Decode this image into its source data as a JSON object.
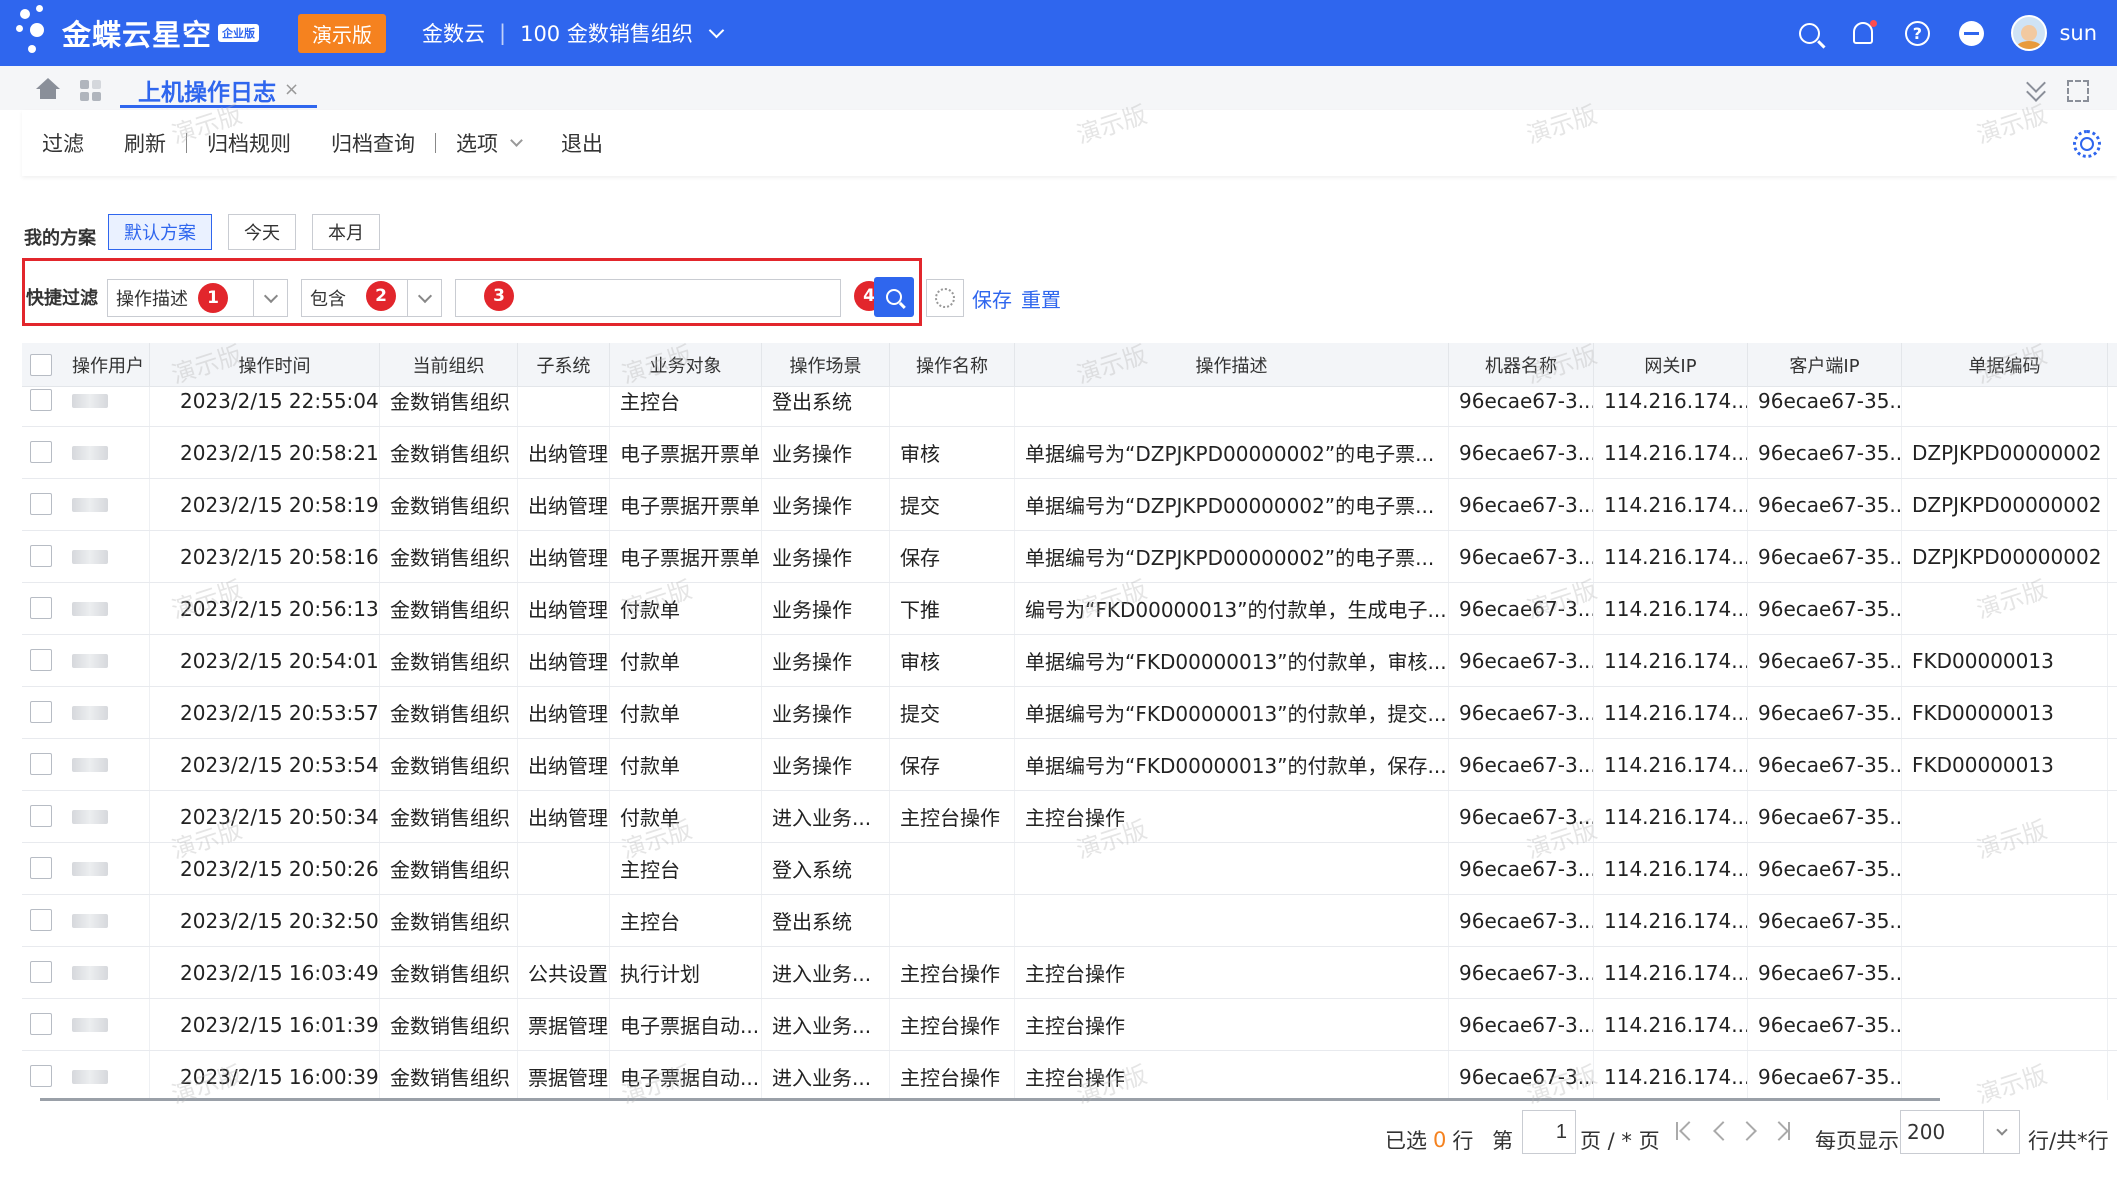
{
  "app": {
    "logo_text": "金蝶云星空",
    "logo_edition": "企业版",
    "demo_badge": "演示版",
    "cloud_name": "金数云",
    "org_name": "100 金数销售组织",
    "username": "sun"
  },
  "tabs": {
    "active_label": "上机操作日志"
  },
  "toolbar": {
    "filter": "过滤",
    "refresh": "刷新",
    "archive_rule": "归档规则",
    "archive_query": "归档查询",
    "options": "选项",
    "exit": "退出"
  },
  "scheme": {
    "label": "我的方案",
    "buttons": [
      "默认方案",
      "今天",
      "本月"
    ],
    "active": "默认方案"
  },
  "quick_filter": {
    "label": "快捷过滤",
    "field_value": "操作描述",
    "operator_value": "包含",
    "keyword_value": "",
    "save": "保存",
    "reset": "重置",
    "badges": [
      "1",
      "2",
      "3",
      "4"
    ]
  },
  "table": {
    "columns": [
      "操作用户",
      "操作时间",
      "当前组织",
      "子系统",
      "业务对象",
      "操作场景",
      "操作名称",
      "操作描述",
      "机器名称",
      "网关IP",
      "客户端IP",
      "单据编码"
    ],
    "rows": [
      [
        "",
        "2023/2/15 22:55:04",
        "金数销售组织",
        "",
        "主控台",
        "登出系统",
        "",
        "",
        "96ecae67-3...",
        "114.216.174....",
        "96ecae67-35...",
        ""
      ],
      [
        "",
        "2023/2/15 20:58:21",
        "金数销售组织",
        "出纳管理",
        "电子票据开票单",
        "业务操作",
        "审核",
        "单据编号为“DZPJKPD00000002”的电子票...",
        "96ecae67-3...",
        "114.216.174....",
        "96ecae67-35...",
        "DZPJKPD00000002"
      ],
      [
        "",
        "2023/2/15 20:58:19",
        "金数销售组织",
        "出纳管理",
        "电子票据开票单",
        "业务操作",
        "提交",
        "单据编号为“DZPJKPD00000002”的电子票...",
        "96ecae67-3...",
        "114.216.174....",
        "96ecae67-35...",
        "DZPJKPD00000002"
      ],
      [
        "",
        "2023/2/15 20:58:16",
        "金数销售组织",
        "出纳管理",
        "电子票据开票单",
        "业务操作",
        "保存",
        "单据编号为“DZPJKPD00000002”的电子票...",
        "96ecae67-3...",
        "114.216.174....",
        "96ecae67-35...",
        "DZPJKPD00000002"
      ],
      [
        "",
        "2023/2/15 20:56:13",
        "金数销售组织",
        "出纳管理",
        "付款单",
        "业务操作",
        "下推",
        "编号为“FKD00000013”的付款单，生成电子...",
        "96ecae67-3...",
        "114.216.174....",
        "96ecae67-35...",
        ""
      ],
      [
        "",
        "2023/2/15 20:54:01",
        "金数销售组织",
        "出纳管理",
        "付款单",
        "业务操作",
        "审核",
        "单据编号为“FKD00000013”的付款单，审核...",
        "96ecae67-3...",
        "114.216.174....",
        "96ecae67-35...",
        "FKD00000013"
      ],
      [
        "",
        "2023/2/15 20:53:57",
        "金数销售组织",
        "出纳管理",
        "付款单",
        "业务操作",
        "提交",
        "单据编号为“FKD00000013”的付款单，提交...",
        "96ecae67-3...",
        "114.216.174....",
        "96ecae67-35...",
        "FKD00000013"
      ],
      [
        "",
        "2023/2/15 20:53:54",
        "金数销售组织",
        "出纳管理",
        "付款单",
        "业务操作",
        "保存",
        "单据编号为“FKD00000013”的付款单，保存...",
        "96ecae67-3...",
        "114.216.174....",
        "96ecae67-35...",
        "FKD00000013"
      ],
      [
        "",
        "2023/2/15 20:50:34",
        "金数销售组织",
        "出纳管理",
        "付款单",
        "进入业务...",
        "主控台操作",
        "主控台操作",
        "96ecae67-3...",
        "114.216.174....",
        "96ecae67-35...",
        ""
      ],
      [
        "",
        "2023/2/15 20:50:26",
        "金数销售组织",
        "",
        "主控台",
        "登入系统",
        "",
        "",
        "96ecae67-3...",
        "114.216.174....",
        "96ecae67-35...",
        ""
      ],
      [
        "",
        "2023/2/15 20:32:50",
        "金数销售组织",
        "",
        "主控台",
        "登出系统",
        "",
        "",
        "96ecae67-3...",
        "114.216.174....",
        "96ecae67-35...",
        ""
      ],
      [
        "",
        "2023/2/15 16:03:49",
        "金数销售组织",
        "公共设置",
        "执行计划",
        "进入业务...",
        "主控台操作",
        "主控台操作",
        "96ecae67-3...",
        "114.216.174....",
        "96ecae67-35...",
        ""
      ],
      [
        "",
        "2023/2/15 16:01:39",
        "金数销售组织",
        "票据管理",
        "电子票据自动...",
        "进入业务...",
        "主控台操作",
        "主控台操作",
        "96ecae67-3...",
        "114.216.174....",
        "96ecae67-35...",
        ""
      ],
      [
        "",
        "2023/2/15 16:00:39",
        "金数销售组织",
        "票据管理",
        "电子票据自动...",
        "进入业务...",
        "主控台操作",
        "主控台操作",
        "96ecae67-3...",
        "114.216.174....",
        "96ecae67-35...",
        ""
      ]
    ]
  },
  "pager": {
    "selected_prefix": "已选",
    "selected_count": "0",
    "selected_suffix": "行",
    "page_prefix": "第",
    "page_value": "1",
    "page_suffix": "页 / * 页",
    "per_page_label": "每页显示",
    "per_page_value": "200",
    "rows_suffix": "行/共*行"
  },
  "watermark_text": "演示版",
  "colors": {
    "brand": "#2f66ee",
    "demo_badge": "#f5821f",
    "annotation_red": "#e2262c"
  }
}
